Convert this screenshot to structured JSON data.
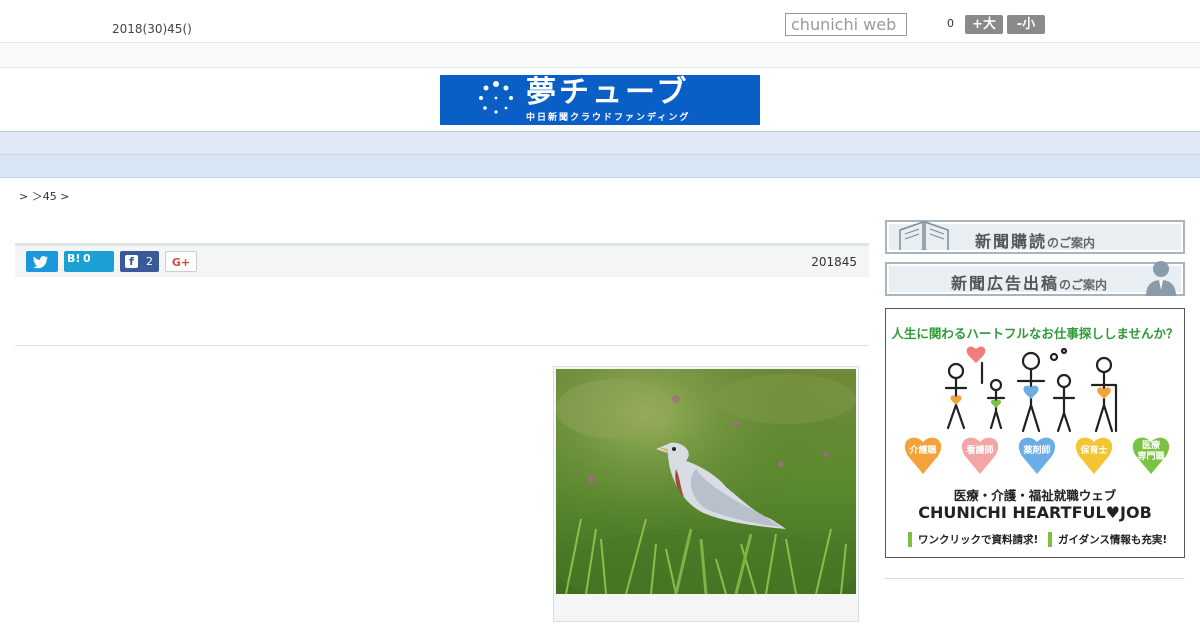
{
  "header": {
    "date_text": "2018(30)45()",
    "search_placeholder": "chunichi web",
    "font_size_count": "0",
    "font_larger_label": "+大",
    "font_smaller_label": "-小"
  },
  "logo": {
    "title": "夢チューブ",
    "subtitle": "中日新聞クラウドファンディング"
  },
  "nav": {
    "items": [
      {
        "label": "　　"
      },
      {
        "label": "　　"
      },
      {
        "label": "　　"
      },
      {
        "label": "　　"
      },
      {
        "label": "　　"
      },
      {
        "label": "　　"
      },
      {
        "label": "　　"
      },
      {
        "label": "　　"
      },
      {
        "label": "　　"
      }
    ]
  },
  "breadcrumb": "> ＞45 >",
  "share": {
    "twitter_icon": "twitter-bird",
    "hatena_label": "B!",
    "hatena_count": "0",
    "facebook_count": "2",
    "gplus_label": "G+",
    "article_date": "201845"
  },
  "sidebar": {
    "subscribe_title": "新聞購読",
    "subscribe_suffix": "のご案内",
    "ad_title": "新聞広告出稿",
    "ad_suffix": "のご案内",
    "banner": {
      "headline": "人生に関わるハートフルなお仕事探ししませんか？",
      "hearts": [
        {
          "label": "介護職",
          "color": "#f4a23a"
        },
        {
          "label": "看護師",
          "color": "#f4a6a6"
        },
        {
          "label": "薬剤師",
          "color": "#6aaee5"
        },
        {
          "label": "保育士",
          "color": "#f5c431"
        },
        {
          "label": "医療\n専門職",
          "color": "#7bc142"
        }
      ],
      "line1": "医療・介護・福祉就職ウェブ",
      "line2": "CHUNICHI HEARTFUL♥JOB",
      "cta1": "ワンクリックで資料請求!",
      "cta2": "ガイダンス情報も充実!"
    }
  },
  "colors": {
    "nav_bg": "#dfeaf6",
    "logo_bg": "#0a5fc6",
    "twitter": "#1a97dd",
    "facebook": "#3b5998"
  }
}
